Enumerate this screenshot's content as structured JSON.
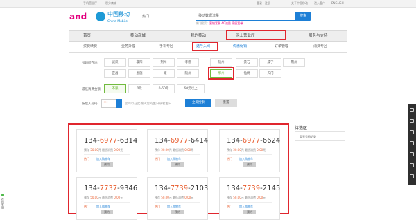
{
  "topbar": {
    "left_items": [
      "手机营业厅",
      "积分商城"
    ],
    "right_items": [
      "登录",
      "注册",
      "关于中国移动",
      "进入客户",
      "ENGLISH"
    ]
  },
  "logo": {
    "brand": "and",
    "name_cn": "中国移动",
    "name_en": "China Mobile"
  },
  "hot_label": "热门",
  "search": {
    "value": "移动数据流量",
    "button": "搜索",
    "hot_prefix": "热门搜索：",
    "hot_terms": [
      "营销套餐",
      "4G流量",
      "家庭宽带"
    ]
  },
  "nav": {
    "items": [
      "首页",
      "移动商城",
      "我的移动",
      "网上营业厅",
      "服务与支持"
    ]
  },
  "subnav": {
    "items": [
      "资费续费",
      "业务办理",
      "手机专区",
      "选号入网",
      "优惠促销",
      "订单管理",
      "消费专区"
    ],
    "active_index": 3
  },
  "filter": {
    "city_label": "号码所在地",
    "cities_row1": [
      "武汉",
      "襄阳",
      "荆州",
      "孝感",
      "随州",
      "黄石",
      "咸宁",
      "荆州"
    ],
    "cities_row2": [
      "宜昌",
      "恩施",
      "十堰",
      "随州",
      "鄂州",
      "仙桃",
      "天门"
    ],
    "selected_city_index": 4,
    "fee_label": "最低消费金额",
    "fees": [
      "不限",
      "0元",
      "0-60元",
      "60元以上"
    ],
    "selected_fee_index": 0,
    "rule_label": "按位入号码",
    "rule_value": "***",
    "rule_hint": "您可以在此输入您的生日或者生日",
    "search_button": "立即搜索",
    "reset_button": "重置"
  },
  "cards": [
    {
      "prefix": "134-",
      "mid": "6977",
      "suffix": "-6314",
      "prepay": "50.00",
      "minimum": "0.00"
    },
    {
      "prefix": "134-",
      "mid": "6977",
      "suffix": "-6414",
      "prepay": "50.00",
      "minimum": "0.00"
    },
    {
      "prefix": "134-",
      "mid": "6977",
      "suffix": "-6624",
      "prepay": "50.00",
      "minimum": "0.00"
    },
    {
      "prefix": "134-",
      "mid": "7737",
      "suffix": "-9346",
      "prepay": "50.00",
      "minimum": "0.00"
    },
    {
      "prefix": "134-",
      "mid": "7739",
      "suffix": "-2103",
      "prepay": "50.00",
      "minimum": "0.00"
    },
    {
      "prefix": "134-",
      "mid": "7739",
      "suffix": "-2145",
      "prepay": "50.00",
      "minimum": "0.00"
    }
  ],
  "card_labels": {
    "prepay": "预存",
    "minimum": "最低消费",
    "unit": "元",
    "hot": "热门",
    "cart": "加入购物车",
    "buy": "预约"
  },
  "side": {
    "title": "待选区",
    "item": "暂无号码记录"
  },
  "online": "在线客服",
  "colors": {
    "brand": "#e3007e",
    "blue": "#1d7fd6",
    "highlight": "#e0262e",
    "accent": "#e85b2c"
  }
}
